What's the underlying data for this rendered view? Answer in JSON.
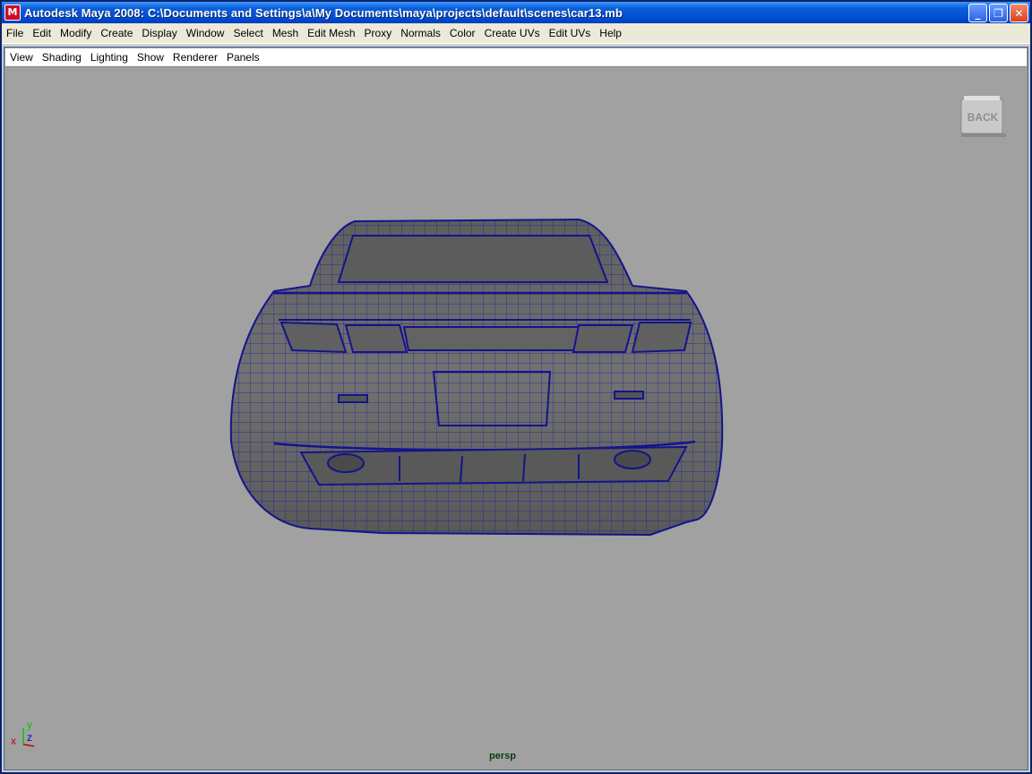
{
  "window": {
    "title": "Autodesk Maya 2008: C:\\Documents and Settings\\a\\My Documents\\maya\\projects\\default\\scenes\\car13.mb",
    "app_icon": "maya-icon",
    "controls": {
      "minimize": "_",
      "maximize": "❐",
      "close": "✕"
    }
  },
  "menubar": {
    "items": [
      "File",
      "Edit",
      "Modify",
      "Create",
      "Display",
      "Window",
      "Select",
      "Mesh",
      "Edit Mesh",
      "Proxy",
      "Normals",
      "Color",
      "Create UVs",
      "Edit UVs",
      "Help"
    ]
  },
  "panel_menu": {
    "items": [
      "View",
      "Shading",
      "Lighting",
      "Show",
      "Renderer",
      "Panels"
    ]
  },
  "viewport": {
    "camera": "persp",
    "viewcube_face": "BACK",
    "axes": {
      "x": "x",
      "y": "y",
      "z": "z"
    },
    "colors": {
      "background": "#a1a1a1",
      "wireframe": "#1a1a9a",
      "shaded": "#6b6b6b"
    }
  }
}
